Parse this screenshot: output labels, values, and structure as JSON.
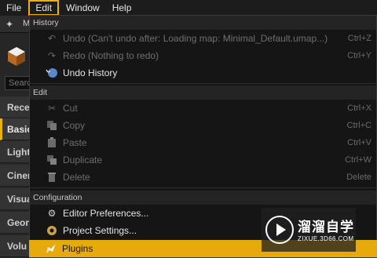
{
  "menubar": {
    "items": [
      {
        "label": "File"
      },
      {
        "label": "Edit",
        "active": true
      },
      {
        "label": "Window"
      },
      {
        "label": "Help"
      }
    ]
  },
  "left_panel": {
    "tab_initial": "M",
    "search_placeholder": "Searc",
    "categories": [
      "Rece",
      "Basic",
      "Light",
      "Ciner",
      "Visua",
      "Geon",
      "Volu"
    ],
    "selected_category": "Basic"
  },
  "dropdown": {
    "sections": {
      "history": "History",
      "edit": "Edit",
      "configuration": "Configuration"
    },
    "items": {
      "undo": {
        "label": "Undo (Can't undo after: Loading map: Minimal_Default.umap...)",
        "shortcut": "Ctrl+Z",
        "icon": "undo-icon",
        "enabled": false
      },
      "redo": {
        "label": "Redo (Nothing to redo)",
        "shortcut": "Ctrl+Y",
        "icon": "redo-icon",
        "enabled": false
      },
      "undo_history": {
        "label": "Undo History",
        "shortcut": "",
        "icon": "undo-history-icon",
        "enabled": true
      },
      "cut": {
        "label": "Cut",
        "shortcut": "Ctrl+X",
        "icon": "scissors-icon",
        "enabled": false
      },
      "copy": {
        "label": "Copy",
        "shortcut": "Ctrl+C",
        "icon": "copy-icon",
        "enabled": false
      },
      "paste": {
        "label": "Paste",
        "shortcut": "Ctrl+V",
        "icon": "paste-icon",
        "enabled": false
      },
      "duplicate": {
        "label": "Duplicate",
        "shortcut": "Ctrl+W",
        "icon": "duplicate-icon",
        "enabled": false
      },
      "delete": {
        "label": "Delete",
        "shortcut": "Delete",
        "icon": "delete-icon",
        "enabled": false
      },
      "editor_preferences": {
        "label": "Editor Preferences...",
        "shortcut": "",
        "icon": "preferences-icon",
        "enabled": true
      },
      "project_settings": {
        "label": "Project Settings...",
        "shortcut": "",
        "icon": "settings-icon",
        "enabled": true
      },
      "plugins": {
        "label": "Plugins",
        "shortcut": "",
        "icon": "plugin-icon",
        "enabled": true,
        "highlighted": true
      }
    }
  },
  "watermark": {
    "title": "溜溜自学",
    "subtitle": "ZIXUE.3D66.COM"
  },
  "colors": {
    "accent": "#e8b40c",
    "highlight": "#e8a90c",
    "menu_bg": "#151515"
  }
}
